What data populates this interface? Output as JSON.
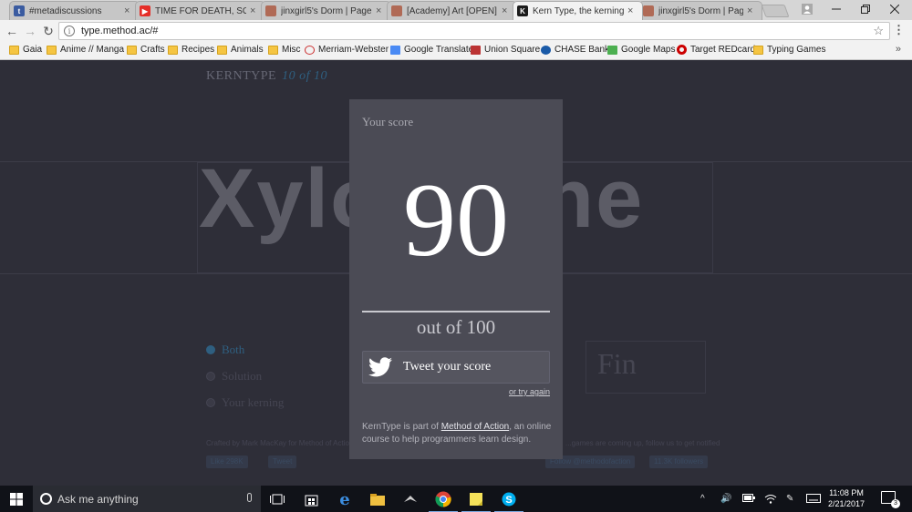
{
  "browser": {
    "tabs": [
      {
        "title": "#metadiscussions",
        "icon": "tumblr-icon",
        "color": "#3a5ba0",
        "active": false
      },
      {
        "title": "TIME FOR DEATH, SONI",
        "icon": "youtube-icon",
        "color": "#e52d27",
        "active": false
      },
      {
        "title": "jinxgirl5's Dorm | Page",
        "icon": "site-icon",
        "color": "#b06a56",
        "active": false
      },
      {
        "title": "[Academy] Art [OPEN] |",
        "icon": "site-icon",
        "color": "#b06a56",
        "active": false
      },
      {
        "title": "Kern Type, the kerning g",
        "icon": "kerntype-icon",
        "color": "#1c1c1c",
        "active": true
      },
      {
        "title": "jinxgirl5's Dorm | Page",
        "icon": "site-icon",
        "color": "#b06a56",
        "active": false
      }
    ],
    "tab_close_glyph": "×",
    "url": "type.method.ac/#",
    "bookmarks": [
      {
        "label": "Gaia",
        "icon": "folder-icon"
      },
      {
        "label": "Anime // Manga",
        "icon": "folder-icon"
      },
      {
        "label": "Crafts",
        "icon": "folder-icon"
      },
      {
        "label": "Recipes",
        "icon": "folder-icon"
      },
      {
        "label": "Animals",
        "icon": "folder-icon"
      },
      {
        "label": "Misc",
        "icon": "folder-icon"
      },
      {
        "label": "Merriam-Webster",
        "icon": "merriam-webster-icon"
      },
      {
        "label": "Google Translate",
        "icon": "google-translate-icon"
      },
      {
        "label": "Union Square",
        "icon": "union-square-icon"
      },
      {
        "label": "CHASE Bank",
        "icon": "chase-icon"
      },
      {
        "label": "Google Maps",
        "icon": "google-maps-icon"
      },
      {
        "label": "Target REDcard",
        "icon": "target-icon"
      },
      {
        "label": "Typing Games",
        "icon": "folder-icon"
      }
    ],
    "bookmarks_more": "»"
  },
  "page": {
    "brand": "KERNTYPE",
    "progress": "10 of 10",
    "word": "Xylophone",
    "options": [
      {
        "label": "Both",
        "selected": true
      },
      {
        "label": "Solution",
        "selected": false
      },
      {
        "label": "Your kerning",
        "selected": false
      }
    ],
    "finish_label": "Fin",
    "credits_left": "Crafted by Mark MacKay for Method of Action",
    "credits_right": "...games are coming up, follow us to get notified",
    "social_left": [
      "Like 298K",
      "Tweet"
    ],
    "social_right": [
      "Follow @methodofaction",
      "11.3K followers"
    ]
  },
  "modal": {
    "label": "Your score",
    "score": "90",
    "out_of": "out of 100",
    "tweet_label": "Tweet your score",
    "try_again": "or try again",
    "about_prefix": "KernType is part of",
    "about_link": "Method of Action",
    "about_suffix": ", an online course to help programmers learn design."
  },
  "taskbar": {
    "search_placeholder": "Ask me anything",
    "time": "11:08 PM",
    "date": "2/21/2017",
    "notifications": "3"
  },
  "colors": {
    "page_bg": "#2e2e38",
    "modal_bg": "#4b4b55",
    "accent": "#2f5f80"
  }
}
